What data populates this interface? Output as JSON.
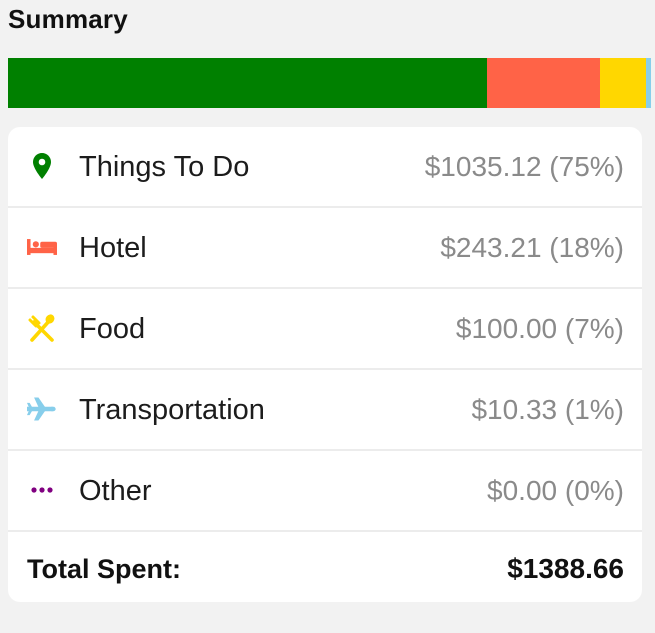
{
  "summary": {
    "title": "Summary"
  },
  "breakdown_bar": {
    "segments": [
      {
        "category": "Things To Do",
        "fraction": 0.7454,
        "color": "#008000"
      },
      {
        "category": "Hotel",
        "fraction": 0.1751,
        "color": "#ff6347"
      },
      {
        "category": "Food",
        "fraction": 0.072,
        "color": "#ffd700"
      },
      {
        "category": "Transportation",
        "fraction": 0.0075,
        "color": "#87ceeb"
      },
      {
        "category": "Other",
        "fraction": 0.0,
        "color": "#800080"
      }
    ]
  },
  "categories": [
    {
      "label": "Things To Do",
      "amount": "$1035.12 (75%)",
      "icon": "map-pin-icon",
      "color": "#008000"
    },
    {
      "label": "Hotel",
      "amount": "$243.21 (18%)",
      "icon": "bed-icon",
      "color": "#ff6347"
    },
    {
      "label": "Food",
      "amount": "$100.00 (7%)",
      "icon": "utensils-icon",
      "color": "#ffd700"
    },
    {
      "label": "Transportation",
      "amount": "$10.33 (1%)",
      "icon": "airplane-icon",
      "color": "#87ceeb"
    },
    {
      "label": "Other",
      "amount": "$0.00 (0%)",
      "icon": "more-dots-icon",
      "color": "#800080"
    }
  ],
  "total": {
    "label": "Total Spent:",
    "value": "$1388.66"
  }
}
